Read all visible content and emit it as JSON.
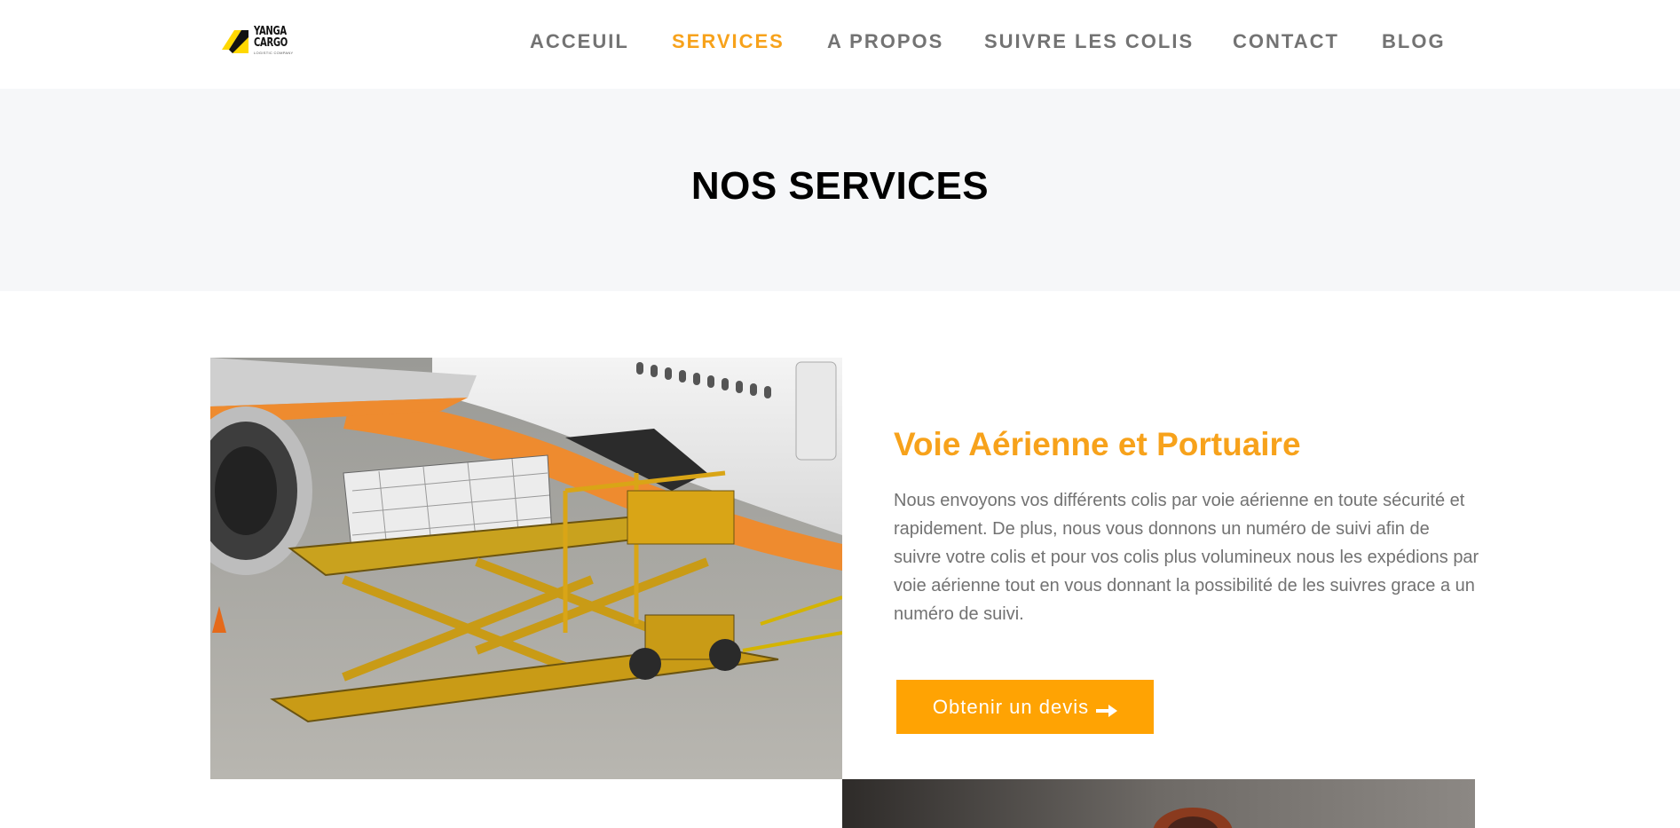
{
  "header": {
    "logo": {
      "name": "YANGA CARGO",
      "tagline": "LOGISTIC COMPANY"
    },
    "nav": [
      {
        "label": "ACCEUIL",
        "active": false
      },
      {
        "label": "SERVICES",
        "active": true
      },
      {
        "label": "A PROPOS",
        "active": false
      },
      {
        "label": "SUIVRE LES COLIS",
        "active": false
      },
      {
        "label": "CONTACT",
        "active": false
      },
      {
        "label": "BLOG",
        "active": false
      }
    ]
  },
  "page_title": "NOS SERVICES",
  "service": {
    "title": "Voie Aérienne et Portuaire",
    "description": "Nous envoyons vos différents colis par voie aérienne en toute sécurité et rapidement. De plus, nous vous donnons un numéro de suivi afin de suivre votre colis et pour vos colis plus volumineux  nous les expédions par voie aérienne tout en vous donnant la possibilité de les suivres grace a un numéro de suivi.",
    "cta_label": "Obtenir un devis",
    "cta_icon": "arrow-right-icon"
  },
  "colors": {
    "accent": "#f7a21b",
    "button": "#ffa303",
    "nav_text": "#737373",
    "title_band": "#f6f7f9"
  }
}
